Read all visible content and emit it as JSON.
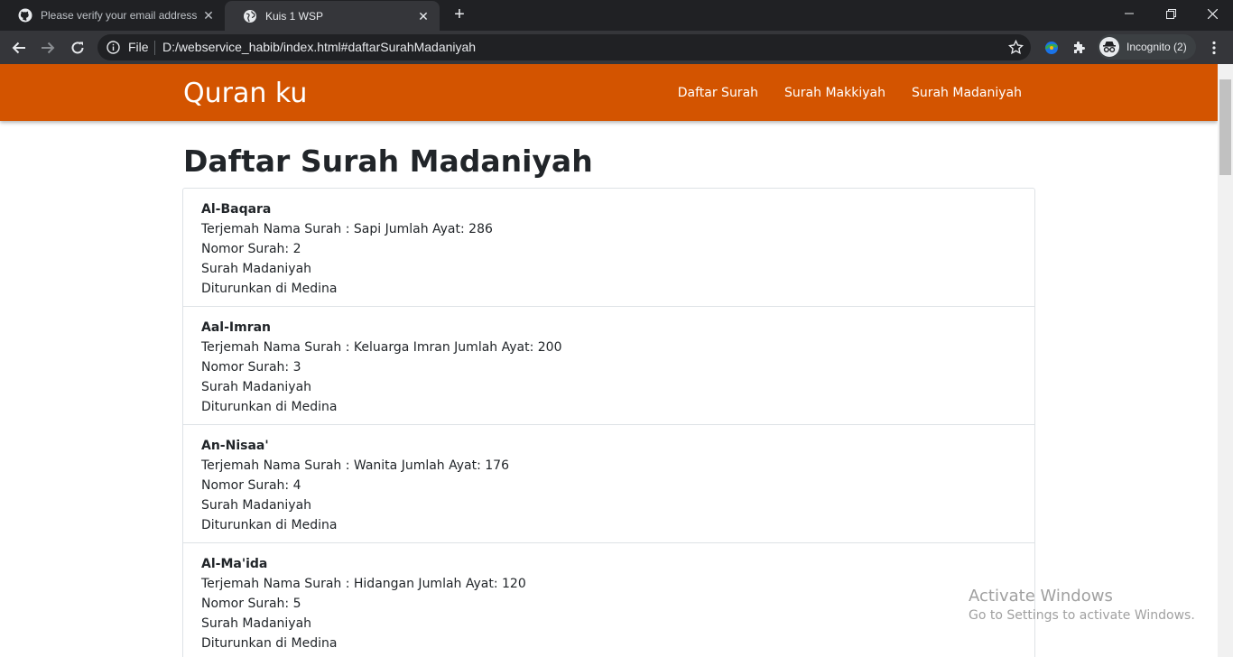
{
  "browser": {
    "tabs": [
      {
        "title": "Please verify your email address",
        "icon": "github-icon"
      },
      {
        "title": "Kuis 1 WSP",
        "icon": "globe-icon"
      }
    ],
    "omnibox": {
      "scheme_label": "File",
      "url": "D:/webservice_habib/index.html#daftarSurahMadaniyah"
    },
    "profile_label": "Incognito (2)"
  },
  "navbar": {
    "brand": "Quran ku",
    "links": [
      "Daftar Surah",
      "Surah Makkiyah",
      "Surah Madaniyah"
    ]
  },
  "page": {
    "heading": "Daftar Surah Madaniyah",
    "surahs": [
      {
        "name": "Al-Baqara",
        "meaning": "Terjemah Nama Surah : Sapi Jumlah Ayat: 286",
        "number": "Nomor Surah: 2",
        "type": "Surah Madaniyah",
        "place": "Diturunkan di Medina"
      },
      {
        "name": "Aal-Imran",
        "meaning": "Terjemah Nama Surah : Keluarga Imran Jumlah Ayat: 200",
        "number": "Nomor Surah: 3",
        "type": "Surah Madaniyah",
        "place": "Diturunkan di Medina"
      },
      {
        "name": "An-Nisaa'",
        "meaning": "Terjemah Nama Surah : Wanita Jumlah Ayat: 176",
        "number": "Nomor Surah: 4",
        "type": "Surah Madaniyah",
        "place": "Diturunkan di Medina"
      },
      {
        "name": "Al-Ma'ida",
        "meaning": "Terjemah Nama Surah : Hidangan Jumlah Ayat: 120",
        "number": "Nomor Surah: 5",
        "type": "Surah Madaniyah",
        "place": "Diturunkan di Medina"
      }
    ]
  },
  "watermark": {
    "title": "Activate Windows",
    "subtitle": "Go to Settings to activate Windows."
  },
  "colors": {
    "navbar": "#d35400",
    "chrome_dark": "#202124",
    "chrome_toolbar": "#35363a"
  }
}
